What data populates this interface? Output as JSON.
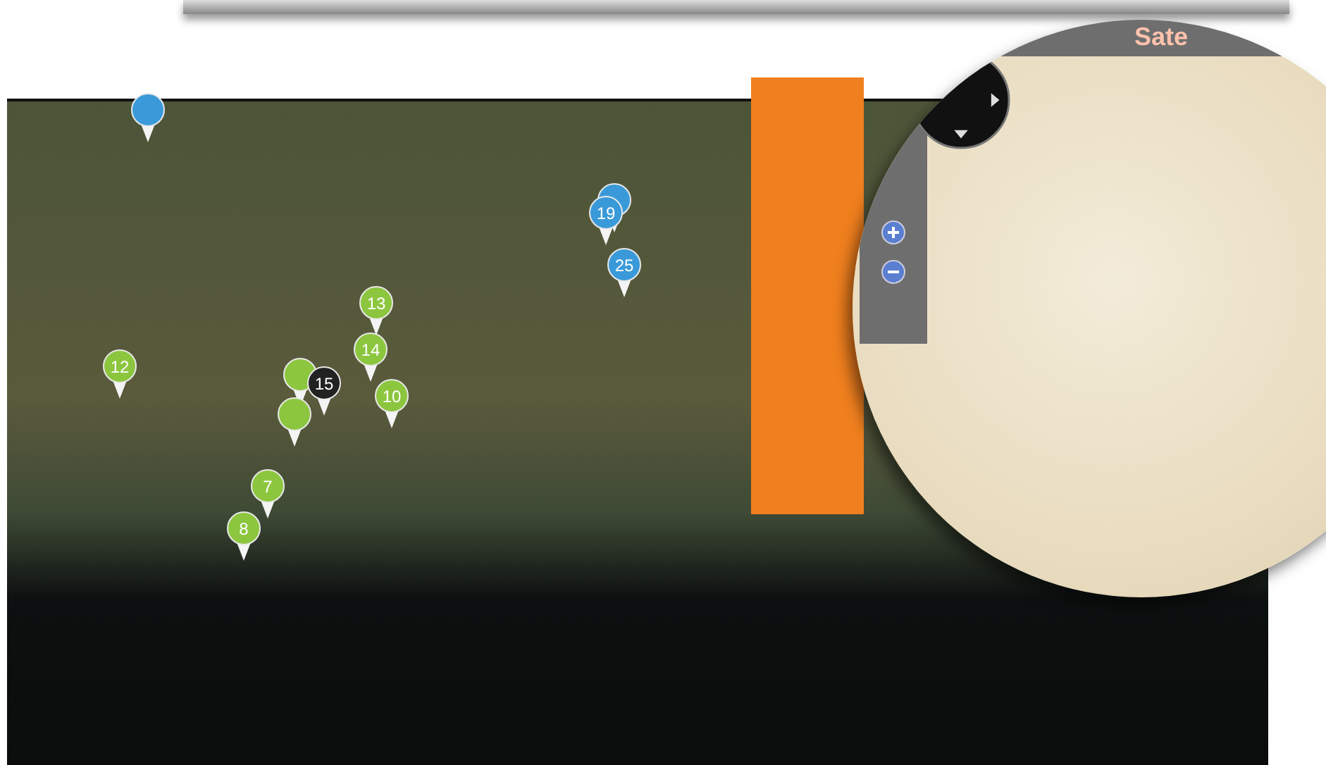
{
  "map": {
    "markers": [
      {
        "color": "#3a9ad9"
      },
      {
        "color": "#3a9ad9"
      },
      {
        "label": "19",
        "color": "#3a9ad9"
      },
      {
        "label": "25",
        "color": "#3a9ad9"
      },
      {
        "label": "13",
        "color": "#8cc63f"
      },
      {
        "label": "14",
        "color": "#8cc63f"
      },
      {
        "label": "12",
        "color": "#8cc63f"
      },
      {
        "color": "#8cc63f"
      },
      {
        "color": "#8cc63f"
      },
      {
        "label": "15",
        "color": "#222222"
      },
      {
        "label": "10",
        "color": "#8cc63f"
      },
      {
        "label": "7",
        "color": "#8cc63f"
      },
      {
        "label": "8",
        "color": "#8cc63f"
      }
    ]
  },
  "lens": {
    "map_type_button": "Sate"
  }
}
